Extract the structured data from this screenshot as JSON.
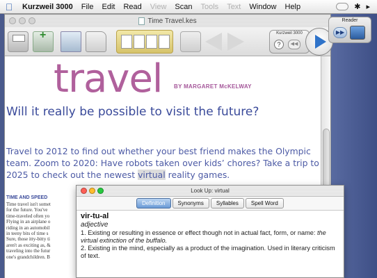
{
  "menubar": {
    "app_name": "Kurzweil 3000",
    "items": [
      "File",
      "Edit",
      "Read",
      "View",
      "Scan",
      "Tools",
      "Text",
      "Window",
      "Help"
    ],
    "disabled": [
      "View",
      "Tools",
      "Text"
    ]
  },
  "window": {
    "title": "Time Travel.kes"
  },
  "toolbar": {
    "kurzweil_label": "Kurzweil 3000",
    "help_button": "?",
    "rewind_button": "◀◀",
    "reader_label": "Reader",
    "reader_ff": "▶▶"
  },
  "document": {
    "big_word": "travel",
    "byline": "BY MARGARET McKELWAY",
    "headline": "Will it really be possible to visit the future?",
    "body_before": "Travel to 2012 to find out whether your best friend makes the Olympic team. Zoom to 2020: Have robots taken over kids’ chores? Take a trip to 2025 to check out the newest ",
    "body_highlight": "virtual",
    "body_after": " reality games.",
    "col_heading": "TIME AND SPEED",
    "col_lines": [
      "Time travel isn't somet",
      "for the future. You've",
      "time-traveled often yo",
      "Flying in an airplane o",
      "riding in an automobil",
      "in teeny bits of time s",
      "Sure, those itty-bitty ti",
      "aren't as exciting as, &",
      "traveling into the futur",
      "one's grandchildren. B"
    ]
  },
  "lookup": {
    "title": "Look Up: virtual",
    "tabs": [
      "Definition",
      "Synonyms",
      "Syllables",
      "Spell Word"
    ],
    "active_tab": "Definition",
    "word": "vir-tu-al",
    "part_of_speech": "adjective",
    "def1_num": "1.",
    "def1_text": " Existing or resulting in essence or effect though not in actual fact, form, or name: ",
    "def1_example": "the virtual extinction of the buffalo.",
    "def2_num": "2.",
    "def2_text": " Existing in the mind, especially as a product of the imagination. Used in literary criticism of text.",
    "dot_colors": [
      "#ff5f56",
      "#ffbd2e",
      "#27c93f"
    ]
  }
}
